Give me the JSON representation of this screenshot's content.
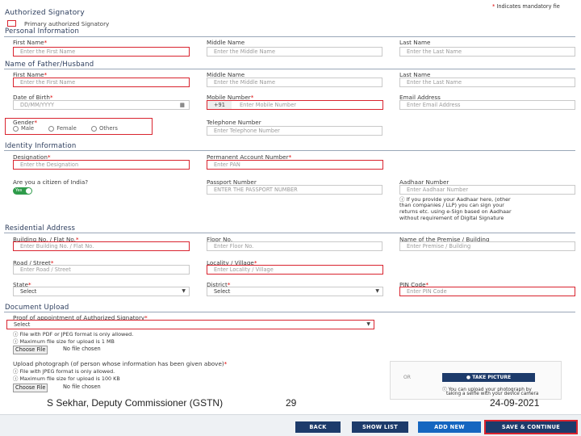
{
  "header": {
    "title": "Authorized Signatory",
    "mandatory_note": "Indicates mandatory fie",
    "primary_checkbox_label": "Primary authorized Signatory"
  },
  "personal": {
    "section_title": "Personal Information",
    "first_name_label": "First Name",
    "first_name_placeholder": "Enter the First Name",
    "middle_name_label": "Middle Name",
    "middle_name_placeholder": "Enter the Middle Name",
    "last_name_label": "Last Name",
    "last_name_placeholder": "Enter the Last Name"
  },
  "father": {
    "section_title": "Name of Father/Husband",
    "first_name_label": "First Name",
    "first_name_placeholder": "Enter the First Name",
    "middle_name_label": "Middle Name",
    "middle_name_placeholder": "Enter the Middle Name",
    "last_name_label": "Last Name",
    "last_name_placeholder": "Enter the Last Name"
  },
  "contact": {
    "dob_label": "Date of Birth",
    "dob_placeholder": "DD/MM/YYYY",
    "mobile_label": "Mobile Number",
    "mobile_code": "+91",
    "mobile_placeholder": "Enter Mobile Number",
    "email_label": "Email Address",
    "email_placeholder": "Enter Email Address",
    "gender_label": "Gender",
    "gender_options": [
      "Male",
      "Female",
      "Others"
    ],
    "telephone_label": "Telephone Number",
    "telephone_placeholder": "Enter Telephone Number"
  },
  "identity": {
    "section_title": "Identity Information",
    "designation_label": "Designation",
    "designation_placeholder": "Enter the Designation",
    "pan_label": "Permanent Account Number",
    "pan_placeholder": "Enter PAN",
    "citizen_label": "Are you a citizen of India?",
    "citizen_toggle": "Yes",
    "passport_label": "Passport Number",
    "passport_placeholder": "ENTER THE PASSPORT NUMBER",
    "aadhaar_label": "Aadhaar Number",
    "aadhaar_placeholder": "Enter Aadhaar Number",
    "aadhaar_note_1": "If you provide your Aadhaar here, (other",
    "aadhaar_note_2": "than companies / LLP) you can sign your",
    "aadhaar_note_3": "returns etc. using e-Sign based on Aadhaar",
    "aadhaar_note_4": "without requirement of Digital Signature"
  },
  "address": {
    "section_title": "Residential Address",
    "building_label": "Building No. / Flat No.",
    "building_placeholder": "Enter Building No. / Flat No.",
    "floor_label": "Floor No.",
    "floor_placeholder": "Enter Floor No.",
    "premise_label": "Name of the Premise / Building",
    "premise_placeholder": "Enter Premise / Building",
    "road_label": "Road / Street",
    "road_placeholder": "Enter Road / Street",
    "locality_label": "Locality / Village",
    "locality_placeholder": "Enter Locality / Village",
    "state_label": "State",
    "state_value": "Select",
    "district_label": "District",
    "district_value": "Select",
    "pin_label": "PIN Code",
    "pin_placeholder": "Enter PIN Code"
  },
  "documents": {
    "section_title": "Document Upload",
    "proof_label": "Proof of appointment of Authorized Signatory",
    "proof_value": "Select",
    "proof_note_1": "File with PDF or JPEG format is only allowed.",
    "proof_note_2": "Maximum file size for upload is 1 MB",
    "choose_file": "Choose File",
    "no_file": "No file chosen",
    "photo_label": "Upload photograph (of person whose information has been given above)",
    "photo_note_1": "File with JPEG format is only allowed.",
    "photo_note_2": "Maximum file size for upload is 100 KB",
    "or_text": "OR",
    "take_picture": "TAKE PICTURE",
    "camera_note_1": "You can upload your photograph by",
    "camera_note_2": "taking a selfie with your device camera"
  },
  "footer": {
    "author": "S Sekhar, Deputy Commissioner (GSTN)",
    "page_number": "29",
    "date": "24-09-2021"
  },
  "actions": {
    "back": "BACK",
    "show_list": "SHOW LIST",
    "add_new": "ADD NEW",
    "save_continue": "SAVE & CONTINUE"
  },
  "colors": {
    "error_border": "#d9242f",
    "primary_dark": "#1d3b6b",
    "primary_blue": "#1566c0",
    "toggle_green": "#2e9b4a"
  }
}
